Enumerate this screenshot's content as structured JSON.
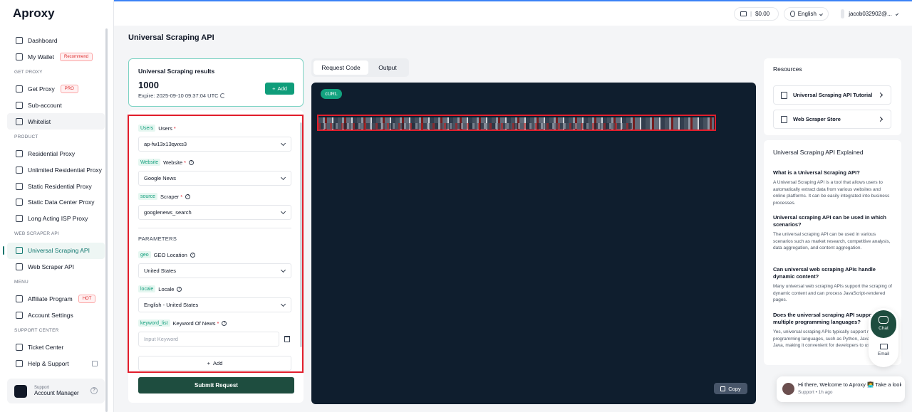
{
  "app": {
    "logo": "Aproxy"
  },
  "header": {
    "balance": "$0.00",
    "language": "English",
    "user": "jacob032902@..."
  },
  "sidebar": {
    "items": [
      {
        "label": "Dashboard"
      },
      {
        "label": "My Wallet",
        "badge": "Recommend"
      }
    ],
    "sections": [
      {
        "title": "GET PROXY",
        "items": [
          {
            "label": "Get Proxy",
            "badge": "PRO"
          },
          {
            "label": "Sub-account"
          },
          {
            "label": "Whitelist"
          }
        ]
      },
      {
        "title": "PRODUCT",
        "items": [
          {
            "label": "Residential Proxy"
          },
          {
            "label": "Unlimited Residential Proxy"
          },
          {
            "label": "Static Residential Proxy"
          },
          {
            "label": "Static Data Center Proxy"
          },
          {
            "label": "Long Acting ISP Proxy"
          }
        ]
      },
      {
        "title": "WEB SCRAPER API",
        "items": [
          {
            "label": "Universal Scraping API"
          },
          {
            "label": "Web Scraper API"
          }
        ]
      },
      {
        "title": "MENU",
        "items": [
          {
            "label": "Affiliate Program",
            "badge": "HOT"
          },
          {
            "label": "Account Settings"
          }
        ]
      },
      {
        "title": "SUPPORT CENTER",
        "items": [
          {
            "label": "Ticket Center"
          },
          {
            "label": "Help & Support"
          }
        ]
      }
    ],
    "support": {
      "small": "Support",
      "label": "Account Manager"
    }
  },
  "page": {
    "title": "Universal Scraping API"
  },
  "results": {
    "title": "Universal Scraping results",
    "value": "1000",
    "expire": "Expire: 2025-09-10 09:37:04 UTC",
    "add": "Add"
  },
  "form": {
    "users": {
      "tag": "Users",
      "label": "Users",
      "value": "ap-fw13x13qwxs3"
    },
    "website": {
      "tag": "Website",
      "label": "Website",
      "value": "Google News"
    },
    "scraper": {
      "tag": "source",
      "label": "Scraper",
      "value": "googlenews_search"
    },
    "parameters_title": "PARAMETERS",
    "geo": {
      "tag": "geo",
      "label": "GEO Location",
      "value": "United States"
    },
    "locale": {
      "tag": "locale",
      "label": "Locale",
      "value": "English - United States"
    },
    "keyword": {
      "tag": "keyword_list",
      "label": "Keyword Of News",
      "placeholder": "Input Keyword"
    },
    "add_keyword": "Add",
    "submit": "Submit Request"
  },
  "code": {
    "tabs": [
      "Request Code",
      "Output"
    ],
    "active_tab": 0,
    "lang_badge": "cURL",
    "copy": "Copy"
  },
  "resources": {
    "title": "Resources",
    "links": [
      "Universal Scraping API Tutorial",
      "Web Scraper Store"
    ]
  },
  "explained": {
    "title": "Universal Scraping API Explained",
    "faqs": [
      {
        "q": "What is a Universal Scraping API?",
        "a": "A Universal Scraping API is a tool that allows users to automatically extract data from various websites and online platforms. It can be easily integrated into business processes."
      },
      {
        "q": "Universal scraping API can be used in which scenarios?",
        "a": "The universal scraping API can be used in various scenarios such as market research, competitive analysis, data aggregation, and content aggregation."
      },
      {
        "q": "Can universal web scraping APIs handle dynamic content?",
        "a": "Many universal web scraping APIs support the scraping of dynamic content and can process JavaScript-rendered pages."
      },
      {
        "q": "Does the universal scraping API support multiple programming languages?",
        "a": "Yes, universal scraping APIs typically support multiple programming languages, such as Python, JavaScript, and Java, making it convenient for developers to use."
      }
    ]
  },
  "chat": {
    "chat_label": "Chat",
    "email_label": "Email"
  },
  "toast": {
    "message": "Hi there, Welcome to Aproxy 👩‍💻 Take a look around",
    "meta": "Support • 1h ago"
  }
}
